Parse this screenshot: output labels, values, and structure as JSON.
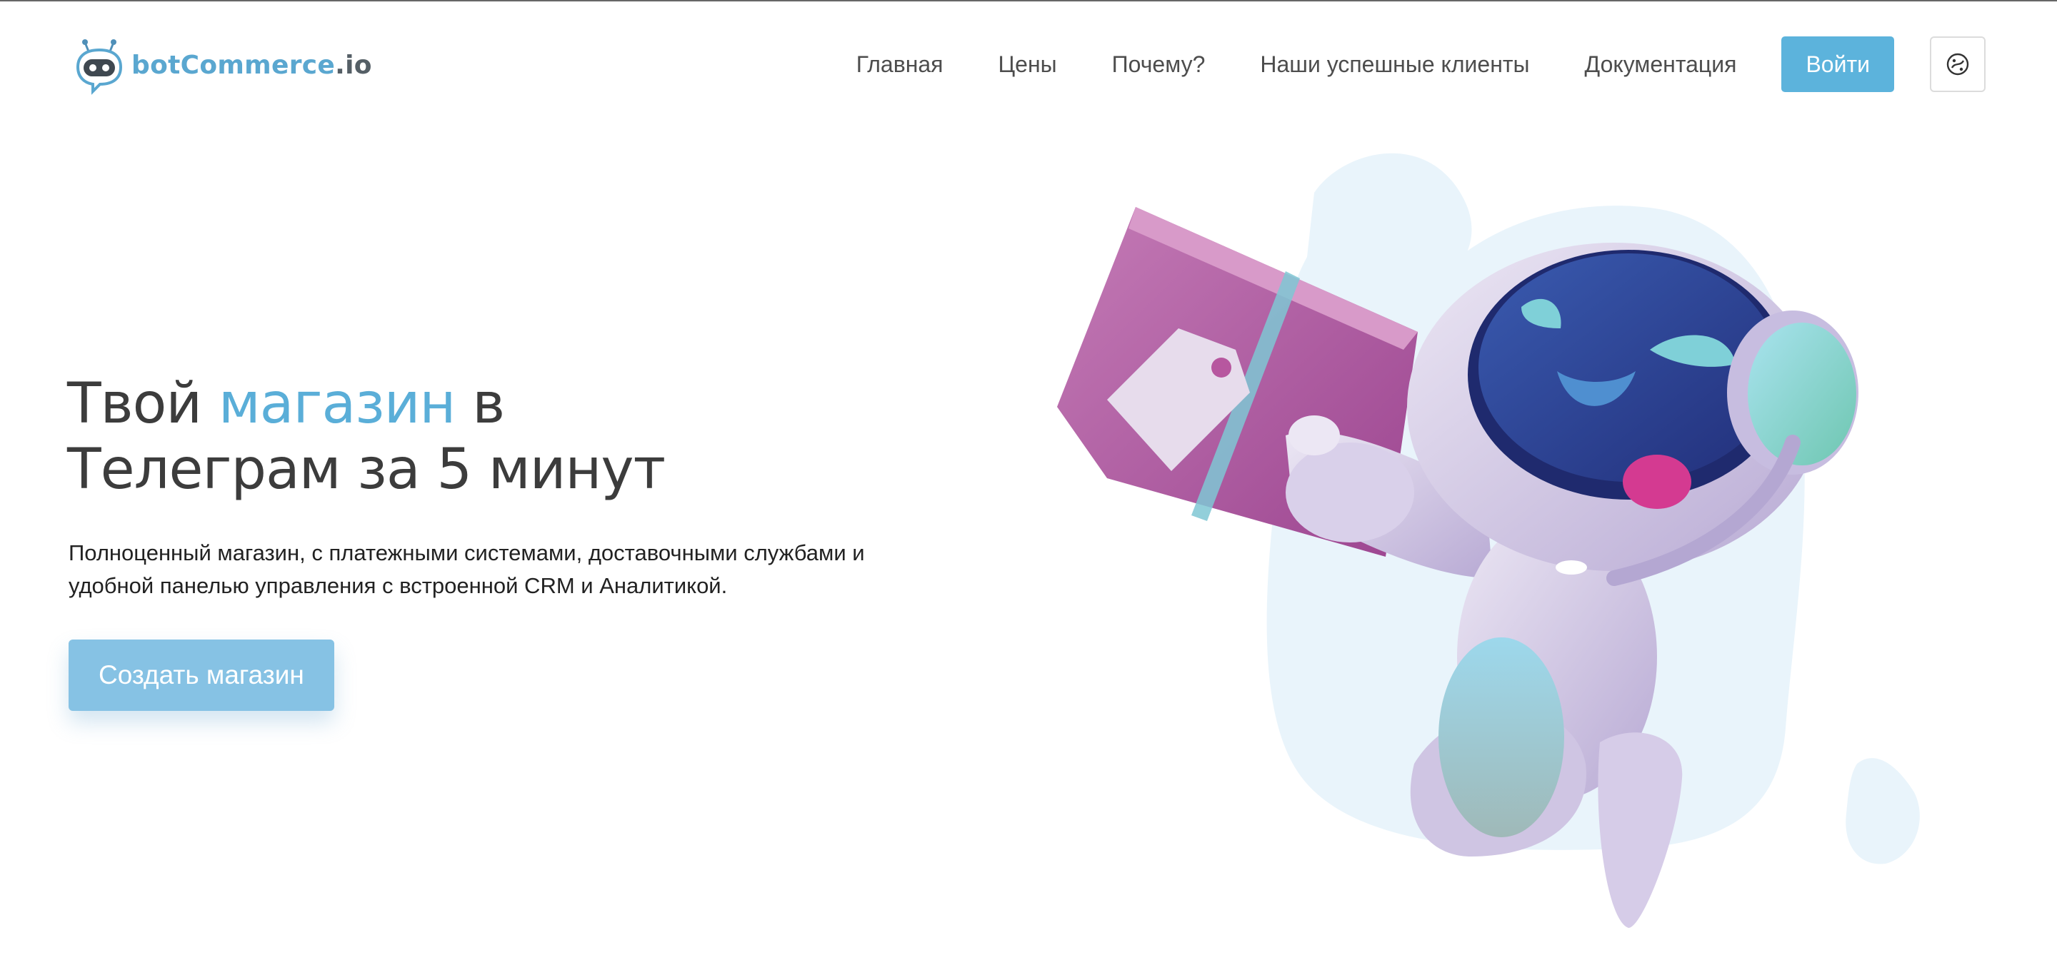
{
  "header": {
    "logo": {
      "part1": "botCommerce",
      "part2": ".io"
    },
    "nav": [
      {
        "label": "Главная"
      },
      {
        "label": "Цены"
      },
      {
        "label": "Почему?"
      },
      {
        "label": "Наши успешные клиенты"
      },
      {
        "label": "Документация"
      }
    ],
    "login_label": "Войти",
    "theme_icon": "palette-icon"
  },
  "hero": {
    "title_part1": "Твой ",
    "title_accent": "магазин",
    "title_part2": " в",
    "title_line2": "Телеграм за 5 минут",
    "subtitle_line1": "Полноценный магазин, с платежными системами, доставочными службами и",
    "subtitle_line2": "удобной панелью управления с встроенной CRM и Аналитикой.",
    "cta_label": "Создать магазин"
  },
  "illustration": {
    "icon": "robot-with-shopping-bag-illustration"
  },
  "colors": {
    "accent": "#5aaed8",
    "login_button": "#5cb3dc",
    "cta_button": "#86c2e4",
    "blob": "#e9f4fb",
    "robot_body": "#d8cfe8",
    "robot_visor": "#2e4a93",
    "bag": "#b7579f"
  }
}
